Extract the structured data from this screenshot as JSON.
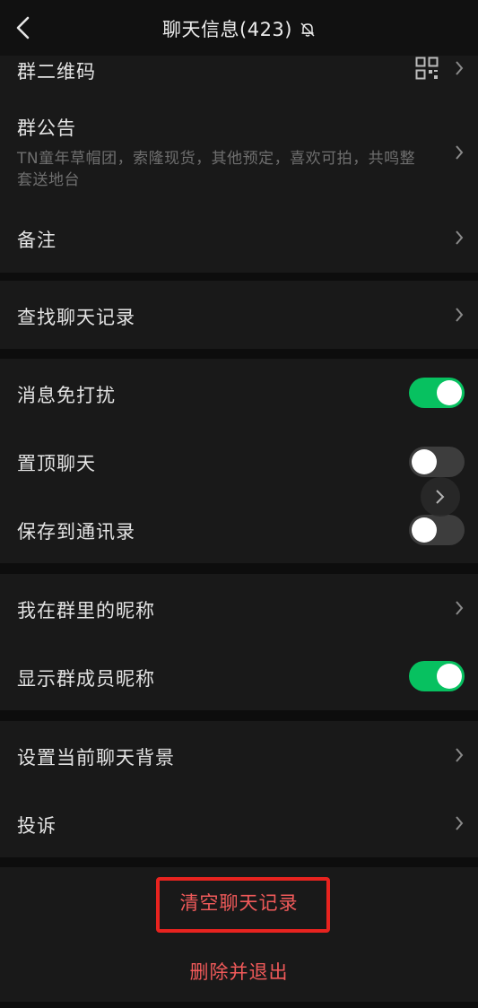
{
  "header": {
    "title": "聊天信息(423)",
    "back_icon": "chevron-left-icon",
    "mute_icon": "bell-off-icon"
  },
  "rows": {
    "qrcode": {
      "label": "群二维码",
      "icon": "qrcode-icon"
    },
    "announcement": {
      "label": "群公告",
      "text": "TN童年草帽团，索隆现货，其他预定，喜欢可拍，共鸣整套送地台"
    },
    "remark": {
      "label": "备注"
    },
    "search_history": {
      "label": "查找聊天记录"
    },
    "do_not_disturb": {
      "label": "消息免打扰",
      "enabled": true
    },
    "sticky_on_top": {
      "label": "置顶聊天",
      "enabled": false
    },
    "save_to_contacts": {
      "label": "保存到通讯录",
      "enabled": false
    },
    "my_nickname": {
      "label": "我在群里的昵称"
    },
    "show_member_nickname": {
      "label": "显示群成员昵称",
      "enabled": true
    },
    "set_background": {
      "label": "设置当前聊天背景"
    },
    "complain": {
      "label": "投诉"
    }
  },
  "actions": {
    "clear_history": "清空聊天记录",
    "delete_and_exit": "删除并退出"
  },
  "colors": {
    "accent_green": "#07c160",
    "danger_red": "#f15a5a",
    "highlight_box": "#e8231f"
  }
}
